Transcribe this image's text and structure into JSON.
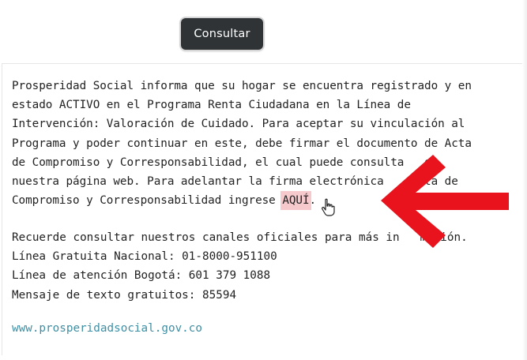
{
  "form": {
    "consultar_label": "Consultar"
  },
  "result": {
    "line1": "Prosperidad Social informa que su hogar se encuentra registrado y en",
    "line2": "estado ACTIVO en el Programa Renta Ciudadana en la Línea de",
    "line3": "Intervención: Valoración de Cuidado. Para aceptar su vinculación al",
    "line4": "Programa y poder continuar en este, debe firmar el documento de Acta",
    "line5": "de Compromiso y Corresponsabilidad, el cual puede consulta   en",
    "line6": "nuestra página web. Para adelantar la firma electrónica    Acta de",
    "line7_before_link": "Compromiso y Corresponsabilidad ingrese ",
    "link_label": "AQUÍ",
    "line7_after_link": "."
  },
  "contact": {
    "intro": "Recuerde consultar nuestros canales oficiales para más in   mación.",
    "line_gratuita": "Línea Gratuita Nacional: 01-8000-951100",
    "line_bogota": "Línea de atención Bogotá: 601 379 1088",
    "line_sms": "Mensaje de texto gratuitos: 85594"
  },
  "footer": {
    "website": "www.prosperidadsocial.gov.co"
  },
  "overlay": {
    "arrow_color": "#e8131c",
    "highlight_color": "#f6c9cc"
  }
}
